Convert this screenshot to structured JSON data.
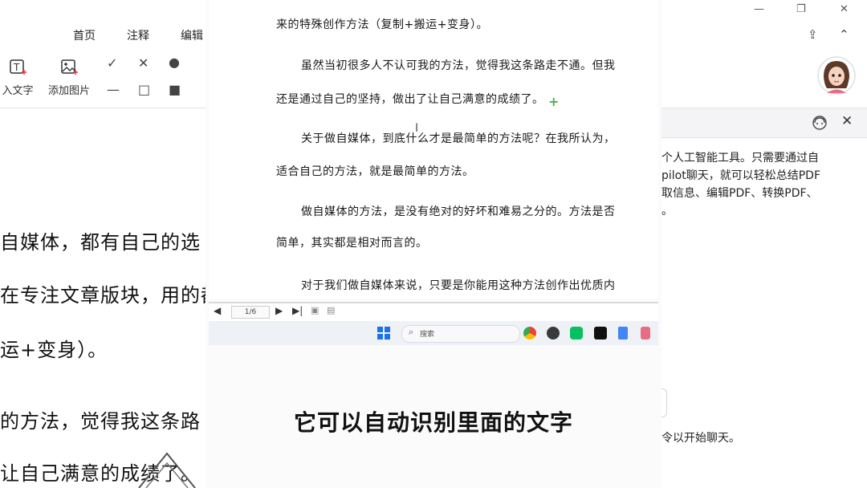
{
  "left_app": {
    "menu": [
      "首页",
      "注释",
      "编辑"
    ],
    "tools": {
      "insert_text": "入文字",
      "add_image": "添加图片"
    },
    "doc_lines": [
      "自媒体，都有自己的选",
      "在专注文章版块，用的都",
      "运+变身）。",
      "的方法，觉得我这条路",
      "让自己满意的成绩了。"
    ]
  },
  "center": {
    "doc_lines": [
      "来的特殊创作方法（复制+搬运+变身）。",
      "虽然当初很多人不认可我的方法，觉得我这条路走不通。但我",
      "还是通过自己的坚持，做出了让自己满意的成绩了。",
      "关于做自媒体，到底什么才是最简单的方法呢？在我所认为，",
      "适合自己的方法，就是最简单的方法。",
      "做自媒体的方法，是没有绝对的好坏和难易之分的。方法是否",
      "简单，其实都是相对而言的。",
      "对于我们做自媒体来说，只要是你能用这种方法创作出优质内"
    ],
    "page_indicator": "1/6",
    "taskbar_search": "搜索",
    "subtitle": "它可以自动识别里面的文字"
  },
  "right_app": {
    "panel_lines": [
      "个人工智能工具。只需要通过自",
      "pilot聊天，就可以轻松总结PDF",
      "取信息、编辑PDF、转换PDF、",
      "。"
    ],
    "chat_hint": "令以开始聊天。"
  },
  "colors": {
    "plus_marker": "#4caf50",
    "taskbar": "#eef2f6",
    "accent_blue": "#1a73e8"
  }
}
